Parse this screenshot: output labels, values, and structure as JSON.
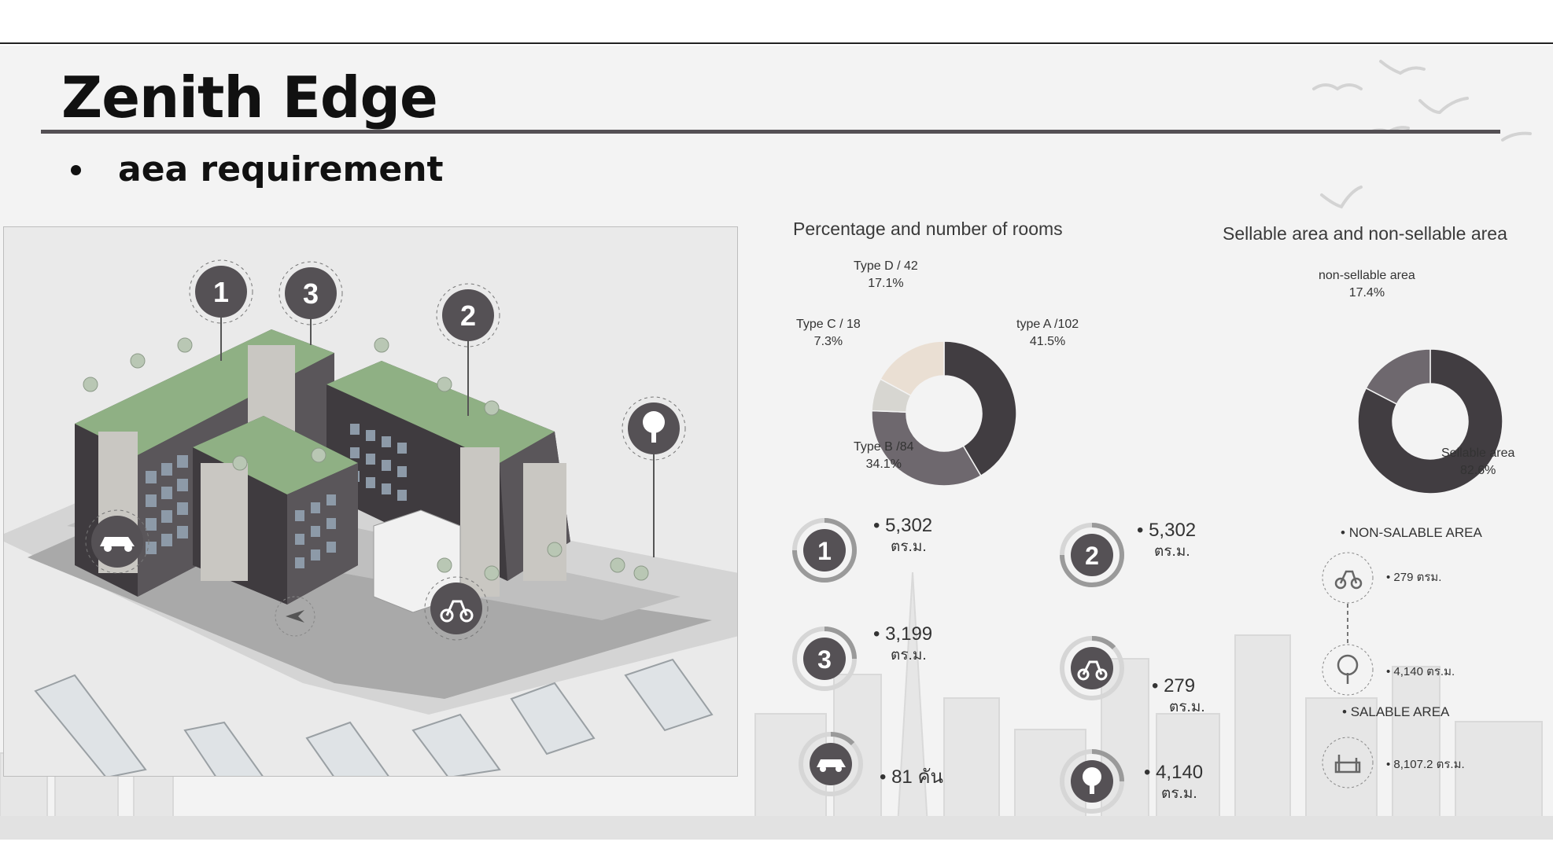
{
  "slide": {
    "title": "Zenith Edge",
    "subtitle": "aea requirement"
  },
  "building_markers": {
    "m1": "1",
    "m2": "2",
    "m3": "3"
  },
  "colors": {
    "dark": "#413d41",
    "mid": "#6e686e",
    "light_grey": "#d7d6d1",
    "beige": "#eadfd3",
    "roof_green": "#8fb084",
    "ground": "#c8c8c8"
  },
  "chart_data": [
    {
      "type": "pie",
      "title": "Percentage and number of rooms",
      "categories": [
        "type A /102",
        "Type B /84",
        "Type C / 18",
        "Type D / 42"
      ],
      "values": [
        41.5,
        34.1,
        7.3,
        17.1
      ],
      "percent_labels": [
        "41.5%",
        "34.1%",
        "7.3%",
        "17.1%"
      ],
      "colors": [
        "#413d41",
        "#6e686e",
        "#d7d6d1",
        "#eadfd3"
      ],
      "donut": true
    },
    {
      "type": "pie",
      "title": "Sellable area and non-sellable area",
      "categories": [
        "Sellable area",
        "non-sellable area"
      ],
      "values": [
        82.6,
        17.4
      ],
      "percent_labels": [
        "82.6%",
        "17.4%"
      ],
      "colors": [
        "#413d41",
        "#6e686e"
      ],
      "donut": true
    }
  ],
  "stats": [
    {
      "icon": "number-1-icon",
      "badge": "1",
      "value": "5,302",
      "unit": "ตร.ม."
    },
    {
      "icon": "number-2-icon",
      "badge": "2",
      "value": "5,302",
      "unit": "ตร.ม."
    },
    {
      "icon": "number-3-icon",
      "badge": "3",
      "value": "3,199",
      "unit": "ตร.ม."
    },
    {
      "icon": "scooter-icon",
      "badge": "",
      "value": "279",
      "unit": "ตร.ม."
    },
    {
      "icon": "car-icon",
      "badge": "",
      "value": "81 คัน",
      "unit": ""
    },
    {
      "icon": "tree-icon",
      "badge": "",
      "value": "4,140",
      "unit": "ตร.ม."
    }
  ],
  "area_legend": {
    "non_salable_title": "NON-SALABLE AREA",
    "non_salable_items": [
      {
        "icon": "scooter-icon",
        "value": "279 ตรม."
      },
      {
        "icon": "tree-icon",
        "value": "4,140 ตร.ม."
      }
    ],
    "salable_title": "SALABLE AREA",
    "salable_items": [
      {
        "icon": "living-room-icon",
        "value": "8,107.2 ตร.ม."
      }
    ]
  }
}
